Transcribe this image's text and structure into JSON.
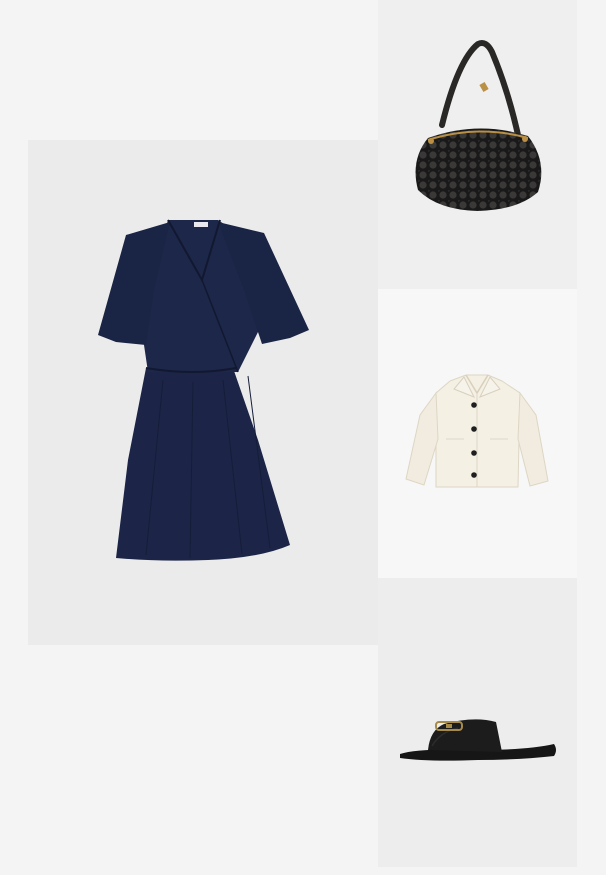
{
  "outfit": {
    "items": [
      {
        "name": "dress",
        "icon": "wrap-dress-image",
        "color": "#1c2547"
      },
      {
        "name": "bag",
        "icon": "woven-shoulder-bag-image",
        "color": "#2e2c2c"
      },
      {
        "name": "jacket",
        "icon": "cropped-jacket-image",
        "color": "#f4f0e4"
      },
      {
        "name": "sandal",
        "icon": "slide-sandal-image",
        "color": "#161616"
      }
    ]
  }
}
